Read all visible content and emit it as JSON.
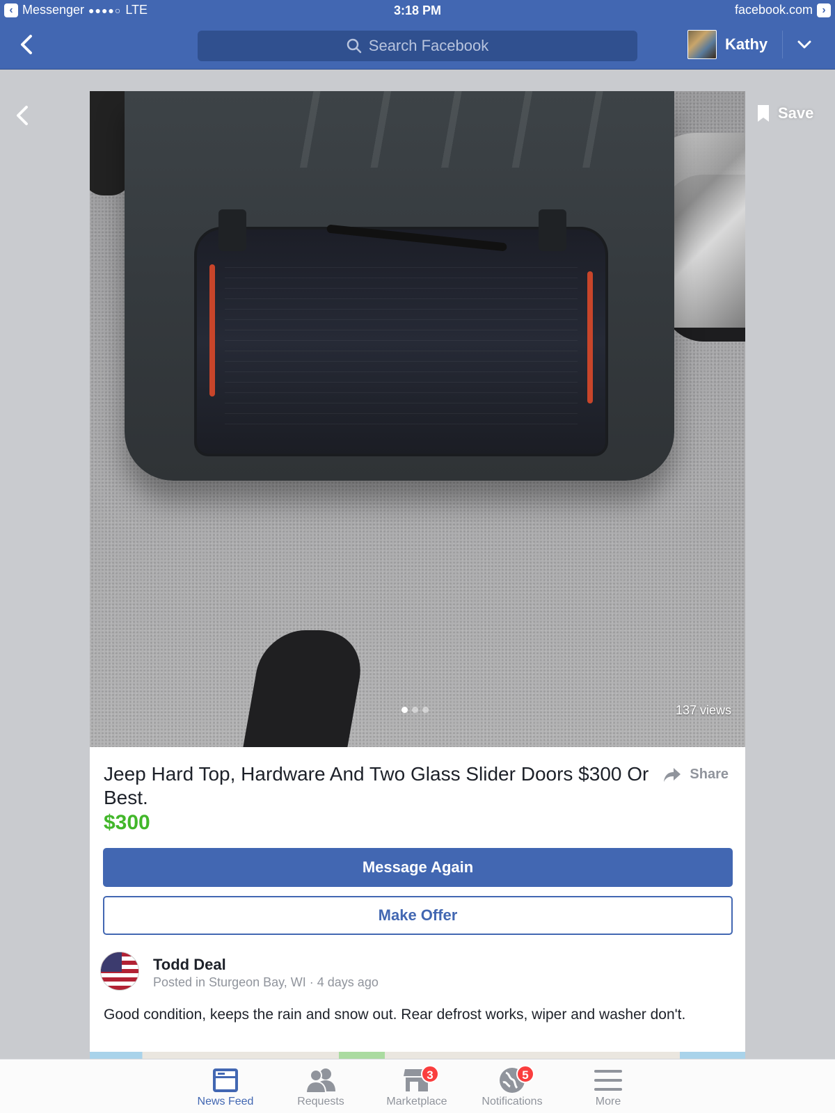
{
  "status_bar": {
    "back_app": "Messenger",
    "signal": "●●●●○",
    "network": "LTE",
    "time": "3:18 PM",
    "site": "facebook.com"
  },
  "nav": {
    "search_placeholder": "Search Facebook",
    "user_name": "Kathy"
  },
  "overlay": {
    "save_label": "Save"
  },
  "photo": {
    "views": "137 views",
    "pager": {
      "total": 3,
      "active_index": 0
    }
  },
  "listing": {
    "title": "Jeep Hard Top, Hardware And Two Glass Slider Doors $300 Or Best.",
    "price": "$300",
    "share_label": "Share",
    "message_button": "Message Again",
    "offer_button": "Make Offer",
    "seller_name": "Todd Deal",
    "seller_meta": "Posted in Sturgeon Bay, WI · 4 days ago",
    "description": "Good condition, keeps the rain and snow out. Rear defrost works, wiper and washer don't."
  },
  "tabbar": {
    "items": [
      {
        "label": "News Feed",
        "icon": "news-feed-icon",
        "active": true
      },
      {
        "label": "Requests",
        "icon": "friend-requests-icon",
        "active": false
      },
      {
        "label": "Marketplace",
        "icon": "marketplace-icon",
        "active": false,
        "badge": "3"
      },
      {
        "label": "Notifications",
        "icon": "globe-notifications-icon",
        "active": false,
        "badge": "5"
      },
      {
        "label": "More",
        "icon": "menu-icon",
        "active": false
      }
    ]
  },
  "colors": {
    "facebook_blue": "#4267b2",
    "price_green": "#42b72a",
    "badge_red": "#fa3e3e"
  }
}
